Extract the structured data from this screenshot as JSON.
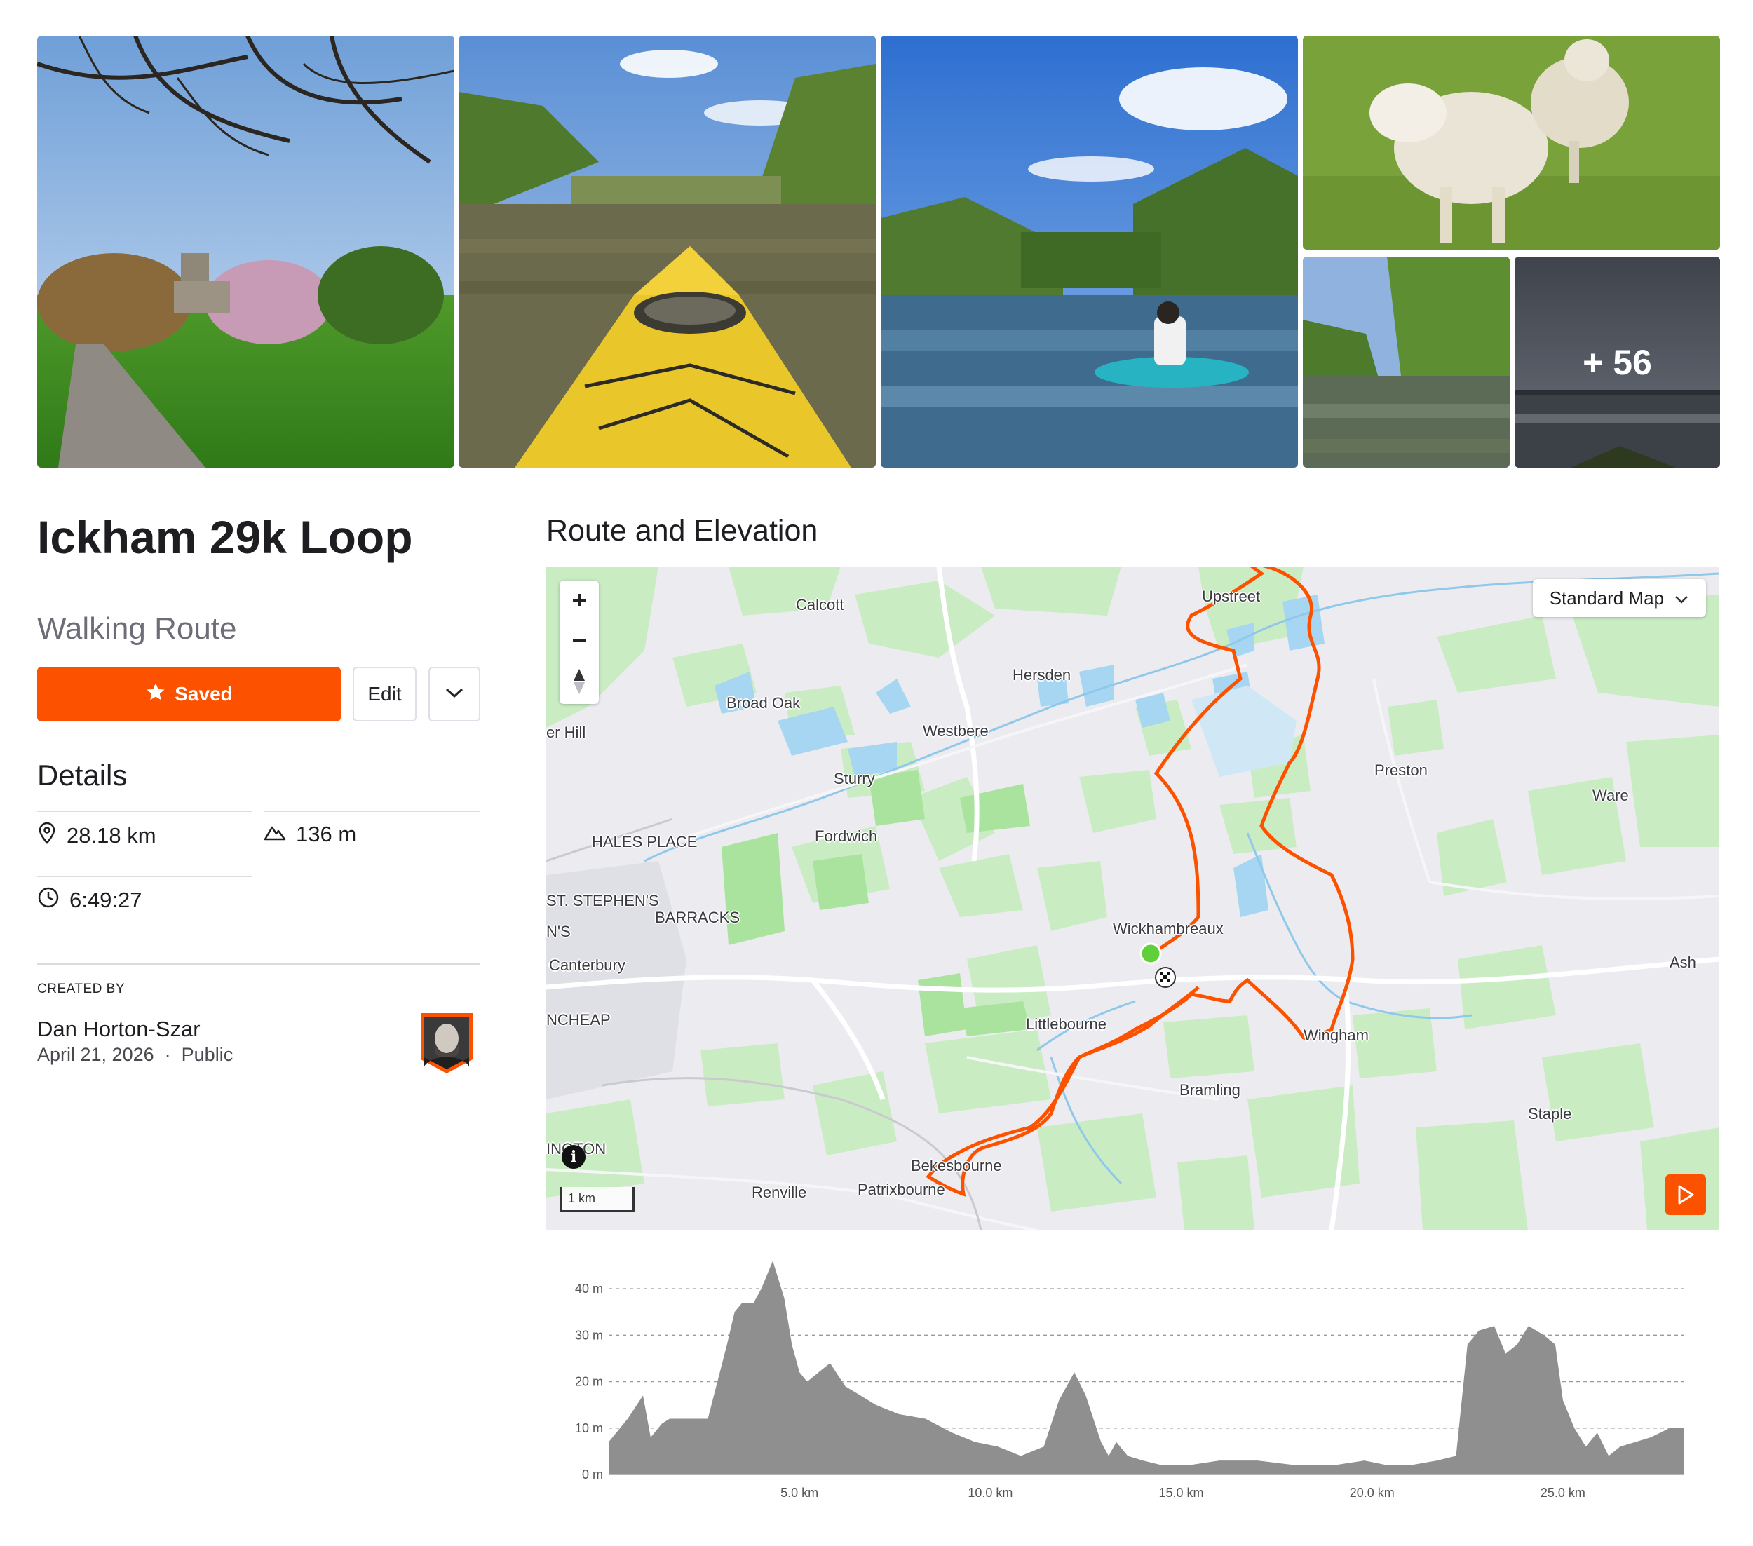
{
  "gallery": {
    "more_count": "+ 56",
    "photos": [
      "church-path-photo",
      "kayak-river-photo",
      "paddleboard-photo",
      "sheep-photo",
      "willow-river-photo",
      "dusk-lake-photo"
    ]
  },
  "route": {
    "title": "Ickham 29k Loop",
    "type": "Walking Route",
    "saved_label": "Saved",
    "edit_label": "Edit"
  },
  "details": {
    "heading": "Details",
    "distance": "28.18 km",
    "elevation_gain": "136 m",
    "moving_time": "6:49:27"
  },
  "creator": {
    "label": "CREATED BY",
    "name": "Dan Horton-Szar",
    "date": "April 21, 2026",
    "visibility": "Public",
    "separator": "·"
  },
  "section_title": "Route and Elevation",
  "map": {
    "style_label": "Standard Map",
    "scale_label": "1 km",
    "route_color": "#fc5200",
    "places": [
      {
        "name": "Calcott",
        "cls": "muted"
      },
      {
        "name": "Upstreet",
        "cls": ""
      },
      {
        "name": "Hersden",
        "cls": ""
      },
      {
        "name": "Broad Oak",
        "cls": ""
      },
      {
        "name": "er Hill",
        "cls": ""
      },
      {
        "name": "Westbere",
        "cls": ""
      },
      {
        "name": "Sturry",
        "cls": ""
      },
      {
        "name": "Preston",
        "cls": ""
      },
      {
        "name": "Ware",
        "cls": "muted"
      },
      {
        "name": "HALES PLACE",
        "cls": "muted"
      },
      {
        "name": "Fordwich",
        "cls": "lg"
      },
      {
        "name": "ST. STEPHEN'S",
        "cls": "muted"
      },
      {
        "name": "BARRACKS",
        "cls": "muted"
      },
      {
        "name": "N'S",
        "cls": "muted"
      },
      {
        "name": "Wickhambreaux",
        "cls": ""
      },
      {
        "name": "Canterbury",
        "cls": "xl"
      },
      {
        "name": "Ash",
        "cls": ""
      },
      {
        "name": "NCHEAP",
        "cls": "muted"
      },
      {
        "name": "Littlebourne",
        "cls": ""
      },
      {
        "name": "Wingham",
        "cls": ""
      },
      {
        "name": "Bramling",
        "cls": ""
      },
      {
        "name": "Staple",
        "cls": ""
      },
      {
        "name": "INGTON",
        "cls": "muted"
      },
      {
        "name": "Bekesbourne",
        "cls": ""
      },
      {
        "name": "Patrixbourne",
        "cls": ""
      },
      {
        "name": "Renville",
        "cls": "muted"
      }
    ]
  },
  "chart_data": {
    "type": "area",
    "title": "",
    "xlabel": "",
    "ylabel": "",
    "x_ticks": [
      "5.0 km",
      "10.0 km",
      "15.0 km",
      "20.0 km",
      "25.0 km"
    ],
    "y_ticks": [
      "0 m",
      "10 m",
      "20 m",
      "30 m",
      "40 m"
    ],
    "xlim": [
      0,
      28.18
    ],
    "ylim": [
      0,
      45
    ],
    "color": "#8f8f8f",
    "series": [
      {
        "x": [
          0,
          0.5,
          0.9,
          1.1,
          1.4,
          1.6,
          2.0,
          2.6,
          3.1,
          3.3,
          3.5,
          3.8,
          4.0,
          4.3,
          4.6,
          4.8,
          5.0,
          5.2,
          5.5,
          5.8,
          6.2,
          6.6,
          7.0,
          7.6,
          8.3,
          9.0,
          9.6,
          10.2,
          10.8,
          11.4,
          11.8,
          12.2,
          12.5,
          12.9,
          13.1,
          13.3,
          13.6,
          14.0,
          14.5,
          15.2,
          16.0,
          17.0,
          18.0,
          19.0,
          19.8,
          20.4,
          21.0,
          21.7,
          22.2,
          22.5,
          22.8,
          23.2,
          23.5,
          23.8,
          24.1,
          24.5,
          24.8,
          25.0,
          25.3,
          25.6,
          25.9,
          26.2,
          26.5,
          26.9,
          27.3,
          27.8,
          28.18
        ],
        "y": [
          7,
          12,
          17,
          8,
          11,
          12,
          12,
          12,
          28,
          35,
          37,
          37,
          40,
          46,
          38,
          28,
          22,
          20,
          22,
          24,
          19,
          17,
          15,
          13,
          12,
          9,
          7,
          6,
          4,
          6,
          16,
          22,
          17,
          7,
          4,
          7,
          4,
          3,
          2,
          2,
          3,
          3,
          2,
          2,
          3,
          2,
          2,
          3,
          4,
          28,
          31,
          32,
          26,
          28,
          32,
          30,
          28,
          16,
          10,
          6,
          9,
          4,
          6,
          7,
          8,
          10,
          10
        ]
      }
    ]
  }
}
